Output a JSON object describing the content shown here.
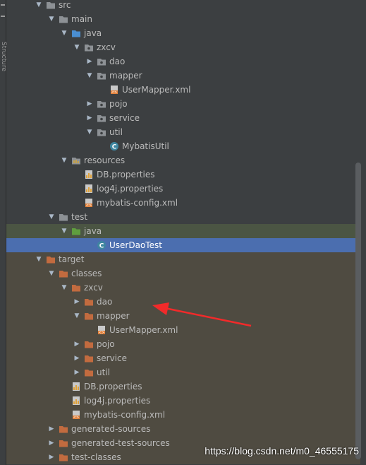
{
  "side_panel": {
    "label": "Structure"
  },
  "tree": [
    {
      "label": "src",
      "indent": 2,
      "icon": "folder-icon",
      "arrow": "expanded",
      "row_style": "normal"
    },
    {
      "label": "main",
      "indent": 3,
      "icon": "folder-icon",
      "arrow": "expanded",
      "row_style": "normal"
    },
    {
      "label": "java",
      "indent": 4,
      "icon": "source-folder-icon",
      "arrow": "expanded",
      "row_style": "normal"
    },
    {
      "label": "zxcv",
      "indent": 5,
      "icon": "package-icon",
      "arrow": "expanded",
      "row_style": "normal"
    },
    {
      "label": "dao",
      "indent": 6,
      "icon": "package-icon",
      "arrow": "collapsed",
      "row_style": "normal"
    },
    {
      "label": "mapper",
      "indent": 6,
      "icon": "package-icon",
      "arrow": "expanded",
      "row_style": "normal"
    },
    {
      "label": "UserMapper.xml",
      "indent": 7,
      "icon": "xml-file-icon",
      "arrow": "none",
      "row_style": "normal"
    },
    {
      "label": "pojo",
      "indent": 6,
      "icon": "package-icon",
      "arrow": "collapsed",
      "row_style": "normal"
    },
    {
      "label": "service",
      "indent": 6,
      "icon": "package-icon",
      "arrow": "collapsed",
      "row_style": "normal"
    },
    {
      "label": "util",
      "indent": 6,
      "icon": "package-icon",
      "arrow": "expanded",
      "row_style": "normal"
    },
    {
      "label": "MybatisUtil",
      "indent": 7,
      "icon": "java-class-icon",
      "arrow": "none",
      "row_style": "normal"
    },
    {
      "label": "resources",
      "indent": 4,
      "icon": "resources-folder-icon",
      "arrow": "expanded",
      "row_style": "normal"
    },
    {
      "label": "DB.properties",
      "indent": 5,
      "icon": "properties-file-icon",
      "arrow": "none",
      "row_style": "normal"
    },
    {
      "label": "log4j.properties",
      "indent": 5,
      "icon": "properties-file-icon",
      "arrow": "none",
      "row_style": "normal"
    },
    {
      "label": "mybatis-config.xml",
      "indent": 5,
      "icon": "xml-file-icon",
      "arrow": "none",
      "row_style": "normal"
    },
    {
      "label": "test",
      "indent": 3,
      "icon": "folder-icon",
      "arrow": "expanded",
      "row_style": "normal"
    },
    {
      "label": "java",
      "indent": 4,
      "icon": "test-source-folder-icon",
      "arrow": "expanded",
      "row_style": "green"
    },
    {
      "label": "UserDaoTest",
      "indent": 6,
      "icon": "java-class-icon",
      "arrow": "none",
      "row_style": "selected"
    },
    {
      "label": "target",
      "indent": 2,
      "icon": "excluded-folder-icon",
      "arrow": "expanded",
      "row_style": "brown"
    },
    {
      "label": "classes",
      "indent": 3,
      "icon": "excluded-folder-icon",
      "arrow": "expanded",
      "row_style": "brown"
    },
    {
      "label": "zxcv",
      "indent": 4,
      "icon": "excluded-folder-icon",
      "arrow": "expanded",
      "row_style": "brown"
    },
    {
      "label": "dao",
      "indent": 5,
      "icon": "excluded-folder-icon",
      "arrow": "collapsed",
      "row_style": "brown"
    },
    {
      "label": "mapper",
      "indent": 5,
      "icon": "excluded-folder-icon",
      "arrow": "expanded",
      "row_style": "brown"
    },
    {
      "label": "UserMapper.xml",
      "indent": 6,
      "icon": "xml-file-icon",
      "arrow": "none",
      "row_style": "brown"
    },
    {
      "label": "pojo",
      "indent": 5,
      "icon": "excluded-folder-icon",
      "arrow": "collapsed",
      "row_style": "brown"
    },
    {
      "label": "service",
      "indent": 5,
      "icon": "excluded-folder-icon",
      "arrow": "collapsed",
      "row_style": "brown"
    },
    {
      "label": "util",
      "indent": 5,
      "icon": "excluded-folder-icon",
      "arrow": "collapsed",
      "row_style": "brown"
    },
    {
      "label": "DB.properties",
      "indent": 4,
      "icon": "properties-file-icon",
      "arrow": "none",
      "row_style": "brown"
    },
    {
      "label": "log4j.properties",
      "indent": 4,
      "icon": "properties-file-icon",
      "arrow": "none",
      "row_style": "brown"
    },
    {
      "label": "mybatis-config.xml",
      "indent": 4,
      "icon": "xml-file-icon",
      "arrow": "none",
      "row_style": "brown"
    },
    {
      "label": "generated-sources",
      "indent": 3,
      "icon": "excluded-folder-icon",
      "arrow": "collapsed",
      "row_style": "brown"
    },
    {
      "label": "generated-test-sources",
      "indent": 3,
      "icon": "excluded-folder-icon",
      "arrow": "collapsed",
      "row_style": "brown"
    },
    {
      "label": "test-classes",
      "indent": 3,
      "icon": "excluded-folder-icon",
      "arrow": "collapsed",
      "row_style": "brown"
    }
  ],
  "watermark": "https://blog.csdn.net/m0_46555175",
  "colors": {
    "background": "#3c3f41",
    "selected_row": "#4b6eaf",
    "test_source_row": "#4b5543",
    "excluded_rows": "#4f4b41",
    "folder_grey": "#8d9195",
    "source_blue": "#4a8ed1",
    "test_green": "#5f9e3f",
    "excluded_orange": "#c26b3f",
    "annotation_red": "#f22a2a"
  }
}
